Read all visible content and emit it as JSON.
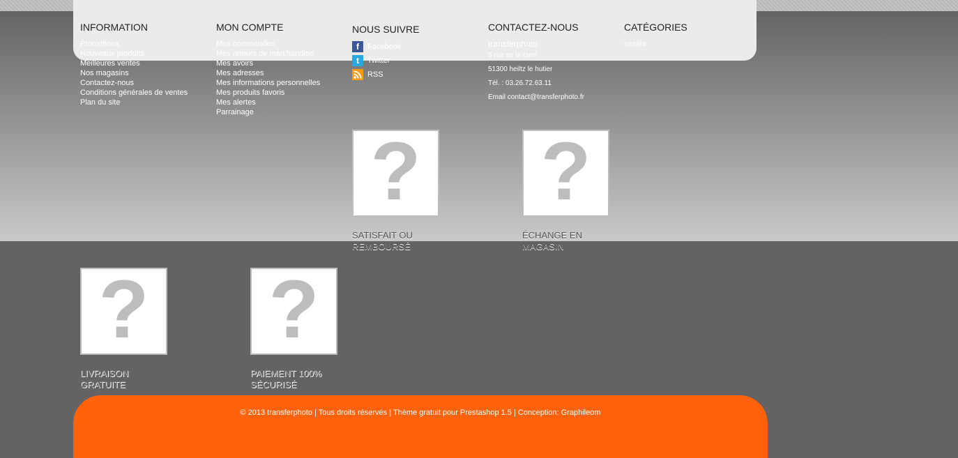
{
  "information": {
    "title": "INFORMATION",
    "items": [
      "Promotions",
      "Nouveaux produits",
      "Meilleures ventes",
      "Nos magasins",
      "Contactez-nous",
      "Conditions générales de ventes",
      "Plan du site"
    ]
  },
  "account": {
    "title": "MON COMPTE",
    "items": [
      "Mes commandes",
      "Mes retours de marchandise",
      "Mes avoirs",
      "Mes adresses",
      "Mes informations personnelles",
      "Mes produits favoris",
      "Mes alertes",
      "Parrainage"
    ]
  },
  "follow": {
    "title": "NOUS SUIVRE",
    "items": [
      {
        "label": "Facebook",
        "icon": "facebook-icon",
        "color": "#3b5998"
      },
      {
        "label": "Twitter",
        "icon": "twitter-icon",
        "color": "#29a9e1"
      },
      {
        "label": "RSS",
        "icon": "rss-icon",
        "color": "#f39c12"
      }
    ]
  },
  "contact": {
    "title": "CONTACTEZ-NOUS",
    "company": "transferphoto",
    "address": "5 rue de la cure",
    "city": "51300 heiltz le hutier",
    "phone": "Tél. : 03.26.72.63.11",
    "email": "Email contact@transferphoto.fr"
  },
  "categories": {
    "title": "CATÉGORIES",
    "items": [
      "essaie"
    ]
  },
  "badges": [
    {
      "caption": "SATISFAIT OU REMBOURSÉ",
      "icon": "question-mark-icon"
    },
    {
      "caption": "ÉCHANGE EN MAGASIN",
      "icon": "question-mark-icon"
    },
    {
      "caption": "LIVRAISON GRATUITE",
      "icon": "question-mark-icon"
    },
    {
      "caption": "PAIEMENT 100% SÉCURISÉ",
      "icon": "question-mark-icon"
    }
  ],
  "footer": {
    "copyright": "© 2013 transferphoto | Tous droits réservés | Thème gratuit pour Prestashop 1.5 | Conception: Graphileom",
    "accent_color": "#ff620c"
  }
}
